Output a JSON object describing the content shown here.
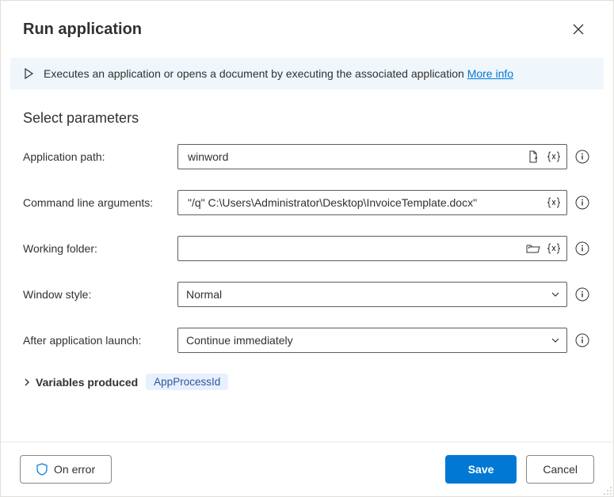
{
  "header": {
    "title": "Run application"
  },
  "info": {
    "text": "Executes an application or opens a document by executing the associated application",
    "link_label": "More info"
  },
  "section_title": "Select parameters",
  "fields": {
    "app_path": {
      "label": "Application path:",
      "value": "winword"
    },
    "cmd_args": {
      "label": "Command line arguments:",
      "value": "\"/q\" C:\\Users\\Administrator\\Desktop\\InvoiceTemplate.docx\""
    },
    "working_folder": {
      "label": "Working folder:",
      "value": ""
    },
    "window_style": {
      "label": "Window style:",
      "value": "Normal"
    },
    "after_launch": {
      "label": "After application launch:",
      "value": "Continue immediately"
    }
  },
  "variables": {
    "toggle_label": "Variables produced",
    "items": [
      "AppProcessId"
    ]
  },
  "footer": {
    "on_error": "On error",
    "save": "Save",
    "cancel": "Cancel"
  }
}
